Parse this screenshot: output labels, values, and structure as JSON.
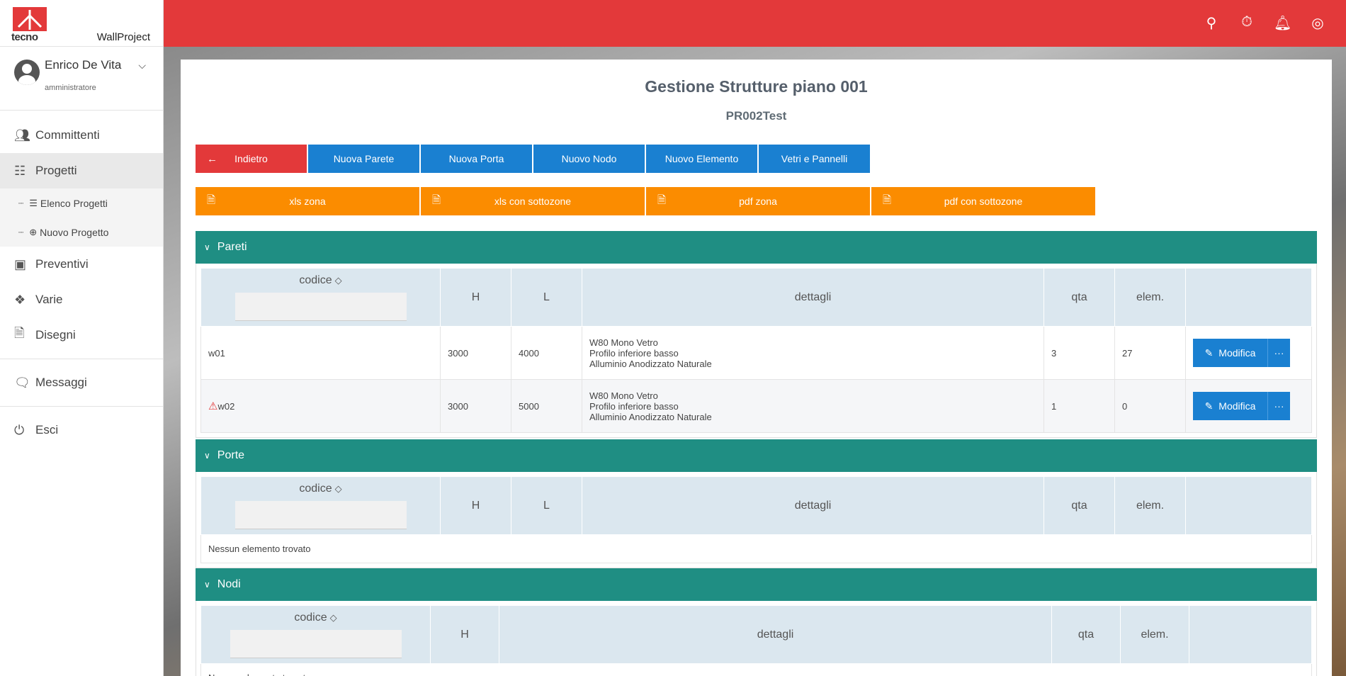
{
  "brand": {
    "logo_text": "tecno",
    "app_name": "WallProject",
    "logo_color": "#e3393a"
  },
  "user": {
    "name": "Enrico De Vita",
    "role": "amministratore"
  },
  "nav": {
    "committenti": "Committenti",
    "progetti": "Progetti",
    "elenco_progetti": "Elenco Progetti",
    "nuovo_progetto": "Nuovo Progetto",
    "preventivi": "Preventivi",
    "varie": "Varie",
    "disegni": "Disegni",
    "messaggi": "Messaggi",
    "esci": "Esci"
  },
  "topbar": {
    "color": "#e3393a",
    "icons": [
      "search-icon",
      "timer-icon",
      "bell-icon",
      "broadcast-icon"
    ]
  },
  "page": {
    "title": "Gestione Strutture piano 001",
    "subtitle": "PR002Test"
  },
  "actions": {
    "back": "Indietro",
    "new_wall": "Nuova Parete",
    "new_door": "Nuova Porta",
    "new_node": "Nuovo Nodo",
    "new_element": "Nuovo Elemento",
    "glass_panels": "Vetri e Pannelli"
  },
  "exports": {
    "xls_zone": "xls zona",
    "xls_subzones": "xls con sottozone",
    "pdf_zone": "pdf zona",
    "pdf_subzones": "pdf con sottozone"
  },
  "columns": {
    "codice": "codice",
    "h": "H",
    "l": "L",
    "dettagli": "dettagli",
    "qta": "qta",
    "elem": "elem."
  },
  "sections": {
    "pareti": {
      "title": "Pareti",
      "rows": [
        {
          "codice": "w01",
          "h": "3000",
          "l": "4000",
          "d1": "W80 Mono Vetro",
          "d2": "Profilo inferiore basso",
          "d3": "Alluminio Anodizzato Naturale",
          "qta": "3",
          "elem": "27"
        },
        {
          "codice": "w02",
          "h": "3000",
          "l": "5000",
          "d1": "W80 Mono Vetro",
          "d2": "Profilo inferiore basso",
          "d3": "Alluminio Anodizzato Naturale",
          "qta": "1",
          "elem": "0"
        }
      ]
    },
    "porte": {
      "title": "Porte",
      "empty": "Nessun elemento trovato"
    },
    "nodi": {
      "title": "Nodi",
      "empty": "Nessun elemento trovato"
    }
  },
  "row_action": {
    "edit": "Modifica",
    "more": "···"
  },
  "colors": {
    "teal": "#1f8e83",
    "blue": "#1a80d1",
    "orange": "#fb8c00",
    "red": "#e3393a"
  }
}
